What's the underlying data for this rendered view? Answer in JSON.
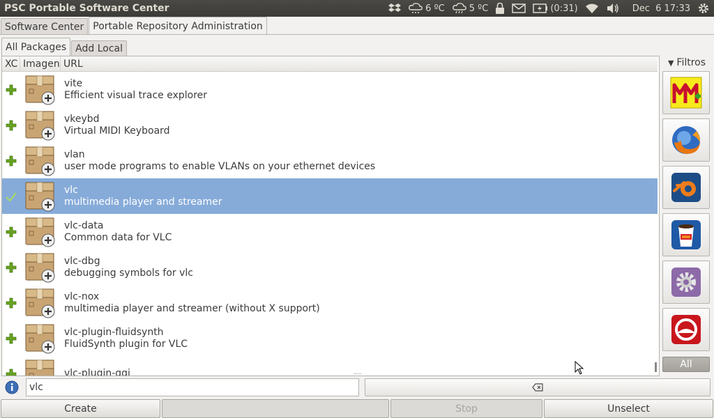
{
  "topbar": {
    "title": "PSC Portable Software Center",
    "weather1": "6 ºC",
    "weather2": "5 ºC",
    "battery": "(0:31)",
    "clock": "Dec  6 17:33"
  },
  "main_tabs": [
    {
      "label": "Software Center",
      "active": false
    },
    {
      "label": "Portable Repository Administration",
      "active": true
    }
  ],
  "inner_tabs": [
    {
      "label": "All Packages",
      "active": true
    },
    {
      "label": "Add Local",
      "active": false
    }
  ],
  "columns": {
    "xc": "XC",
    "image": "Imagen",
    "url": "URL"
  },
  "packages": [
    {
      "name": "vite",
      "desc": "Efficient visual trace explorer",
      "status": "add",
      "selected": false
    },
    {
      "name": "vkeybd",
      "desc": "Virtual MIDI Keyboard",
      "status": "add",
      "selected": false
    },
    {
      "name": "vlan",
      "desc": "user mode programs to enable VLANs on your ethernet devices",
      "status": "add",
      "selected": false
    },
    {
      "name": "vlc",
      "desc": "multimedia player and streamer",
      "status": "installed",
      "selected": true
    },
    {
      "name": "vlc-data",
      "desc": "Common data for VLC",
      "status": "add",
      "selected": false
    },
    {
      "name": "vlc-dbg",
      "desc": "debugging symbols for vlc",
      "status": "add",
      "selected": false
    },
    {
      "name": "vlc-nox",
      "desc": "multimedia player and streamer (without X support)",
      "status": "add",
      "selected": false
    },
    {
      "name": "vlc-plugin-fluidsynth",
      "desc": "FluidSynth plugin for VLC",
      "status": "add",
      "selected": false
    },
    {
      "name": "vlc-plugin-ggi",
      "desc": "",
      "status": "add",
      "selected": false
    }
  ],
  "filters": {
    "label": "Filtros",
    "all_label": "All",
    "icons": [
      "mm-icon",
      "firefox-icon",
      "blender-icon",
      "coffee-cup-icon",
      "settings-gear-icon",
      "red-circle-app-icon"
    ]
  },
  "search": {
    "value": "vlc"
  },
  "buttons": {
    "create": "Create",
    "stop": "Stop",
    "unselect": "Unselect"
  },
  "colors": {
    "selection": "#86abd9",
    "panel": "#3c3b37",
    "plus": "#6aa321"
  }
}
